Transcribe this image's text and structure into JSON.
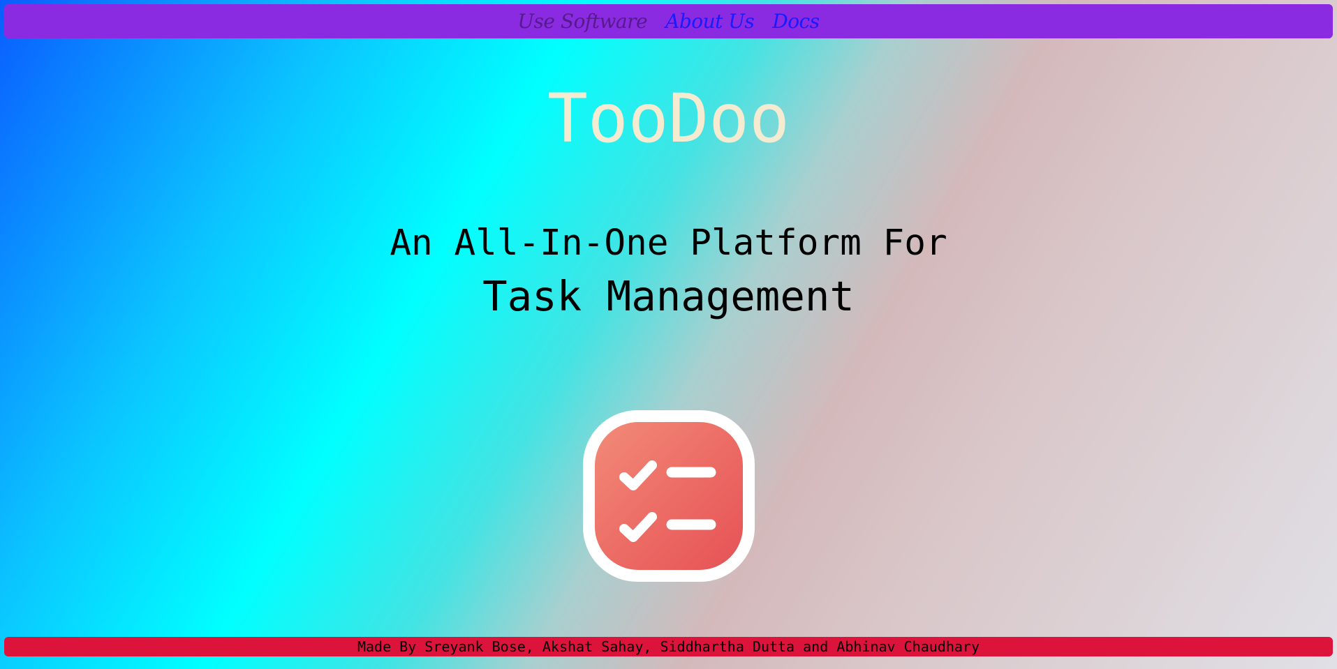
{
  "nav": {
    "links": [
      {
        "label": "Use Software",
        "state": "visited"
      },
      {
        "label": "About Us",
        "state": "link"
      },
      {
        "label": "Docs",
        "state": "link"
      }
    ]
  },
  "hero": {
    "title": "TooDoo",
    "tagline_line1": "An All-In-One Platform For",
    "tagline_line2": "Task Management"
  },
  "logo": {
    "icon": "checklist-icon",
    "colors": {
      "frame": "#ffffff",
      "fill_start": "#f28b78",
      "fill_end": "#e55256"
    }
  },
  "footer": {
    "credits": "Made By Sreyank Bose, Akshat Sahay, Siddhartha Dutta and Abhinav Chaudhary"
  },
  "colors": {
    "navbar": "#8a2be2",
    "footer": "#dc143c",
    "title": "#f5ebd0",
    "link": "#1a1aff",
    "visited_link": "#551a8b"
  }
}
